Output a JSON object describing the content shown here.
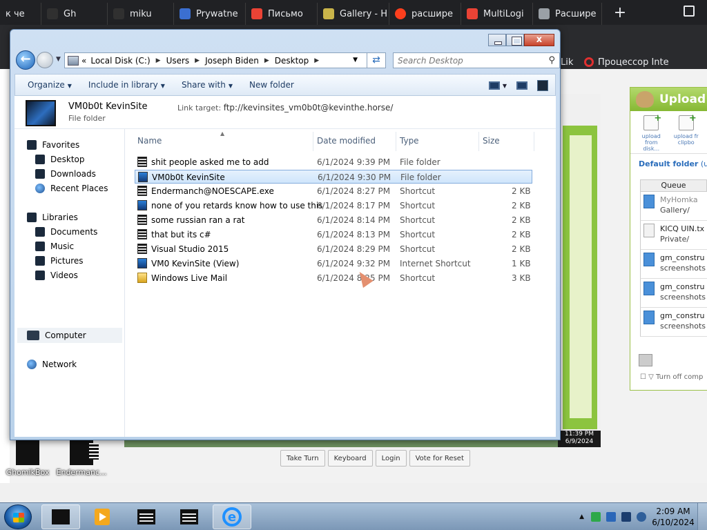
{
  "browser": {
    "tabs": [
      {
        "label": "к че",
        "color": "#303030"
      },
      {
        "label": "Gh",
        "color": "#303030"
      },
      {
        "label": "miku",
        "color": "#303030"
      },
      {
        "label": "Prywatne",
        "color": "#3b6fd1"
      },
      {
        "label": "Письмо",
        "color": "#ea4335"
      },
      {
        "label": "Gallery - H",
        "color": "#c9b44a"
      },
      {
        "label": "расшире",
        "color": "#fc3f1d"
      },
      {
        "label": "MultiLogi",
        "color": "#ea4335"
      },
      {
        "label": "Расшире",
        "color": "#9aa0a6"
      }
    ],
    "new_tab": "+",
    "bookmarks": [
      {
        "label": "Процессор Inte"
      },
      {
        "label": "Lik"
      }
    ]
  },
  "explorer": {
    "close_glyph": "x",
    "back_glyph": "←",
    "address": {
      "prefix": "«",
      "segments": [
        "Local Disk (C:)",
        "Users",
        "Joseph Biden",
        "Desktop"
      ]
    },
    "search_placeholder": "Search Desktop",
    "toolbar": {
      "organize": "Organize",
      "include": "Include in library",
      "share": "Share with",
      "new_folder": "New folder"
    },
    "details": {
      "name": "VM0b0t KevinSite",
      "link_label": "Link target:",
      "link_value": "ftp://kevinsites_vm0b0t@kevinthe.horse/",
      "type": "File folder"
    },
    "nav": {
      "favorites": "Favorites",
      "desktop": "Desktop",
      "downloads": "Downloads",
      "recent": "Recent Places",
      "libraries": "Libraries",
      "documents": "Documents",
      "music": "Music",
      "pictures": "Pictures",
      "videos": "Videos",
      "computer": "Computer",
      "network": "Network"
    },
    "columns": {
      "name": "Name",
      "date": "Date modified",
      "type": "Type",
      "size": "Size"
    },
    "files": [
      {
        "name": "shit people asked me to add",
        "date": "6/1/2024 9:39 PM",
        "type": "File folder",
        "size": ""
      },
      {
        "name": "VM0b0t KevinSite",
        "date": "6/1/2024 9:30 PM",
        "type": "File folder",
        "size": ""
      },
      {
        "name": "Endermanch@NOESCAPE.exe",
        "date": "6/1/2024 8:27 PM",
        "type": "Shortcut",
        "size": "2 KB"
      },
      {
        "name": "none of you retards know how to use this",
        "date": "6/1/2024 8:17 PM",
        "type": "Shortcut",
        "size": "2 KB"
      },
      {
        "name": "some russian ran a rat",
        "date": "6/1/2024 8:14 PM",
        "type": "Shortcut",
        "size": "2 KB"
      },
      {
        "name": "that but its c#",
        "date": "6/1/2024 8:13 PM",
        "type": "Shortcut",
        "size": "2 KB"
      },
      {
        "name": "Visual Studio 2015",
        "date": "6/1/2024 8:29 PM",
        "type": "Shortcut",
        "size": "2 KB"
      },
      {
        "name": "VM0 KevinSite (View)",
        "date": "6/1/2024 9:32 PM",
        "type": "Internet Shortcut",
        "size": "1 KB"
      },
      {
        "name": "Windows Live Mail",
        "date": "6/1/2024 8:25 PM",
        "type": "Shortcut",
        "size": "3 KB"
      }
    ]
  },
  "remote": {
    "time": "11:39 PM",
    "date": "6/9/2024",
    "buttons": {
      "take_turn": "Take Turn",
      "keyboard": "Keyboard",
      "login": "Login",
      "vote": "Vote for Reset"
    }
  },
  "upload": {
    "title": "Upload",
    "from_disk": "upload from disk...",
    "from_clip": "upload fr clipbo",
    "default_folder": "Default folder",
    "default_folder_suffix": "(un",
    "queue": "Queue",
    "items": [
      {
        "l1": "MyHomka",
        "l2": "Gallery/"
      },
      {
        "l1": "KICQ UIN.tx",
        "l2": "Private/"
      },
      {
        "l1": "gm_constru",
        "l2": "screenshots"
      },
      {
        "l1": "gm_constru",
        "l2": "screenshots"
      },
      {
        "l1": "gm_constru",
        "l2": "screenshots"
      }
    ],
    "turn_off": "Turn off comp"
  },
  "desktop_icons": {
    "gomikbox": "GhomikBox",
    "enderman": "Endermanc..."
  },
  "taskbar": {
    "time": "2:09 AM",
    "date": "6/10/2024",
    "tray_arrow": "▲"
  }
}
